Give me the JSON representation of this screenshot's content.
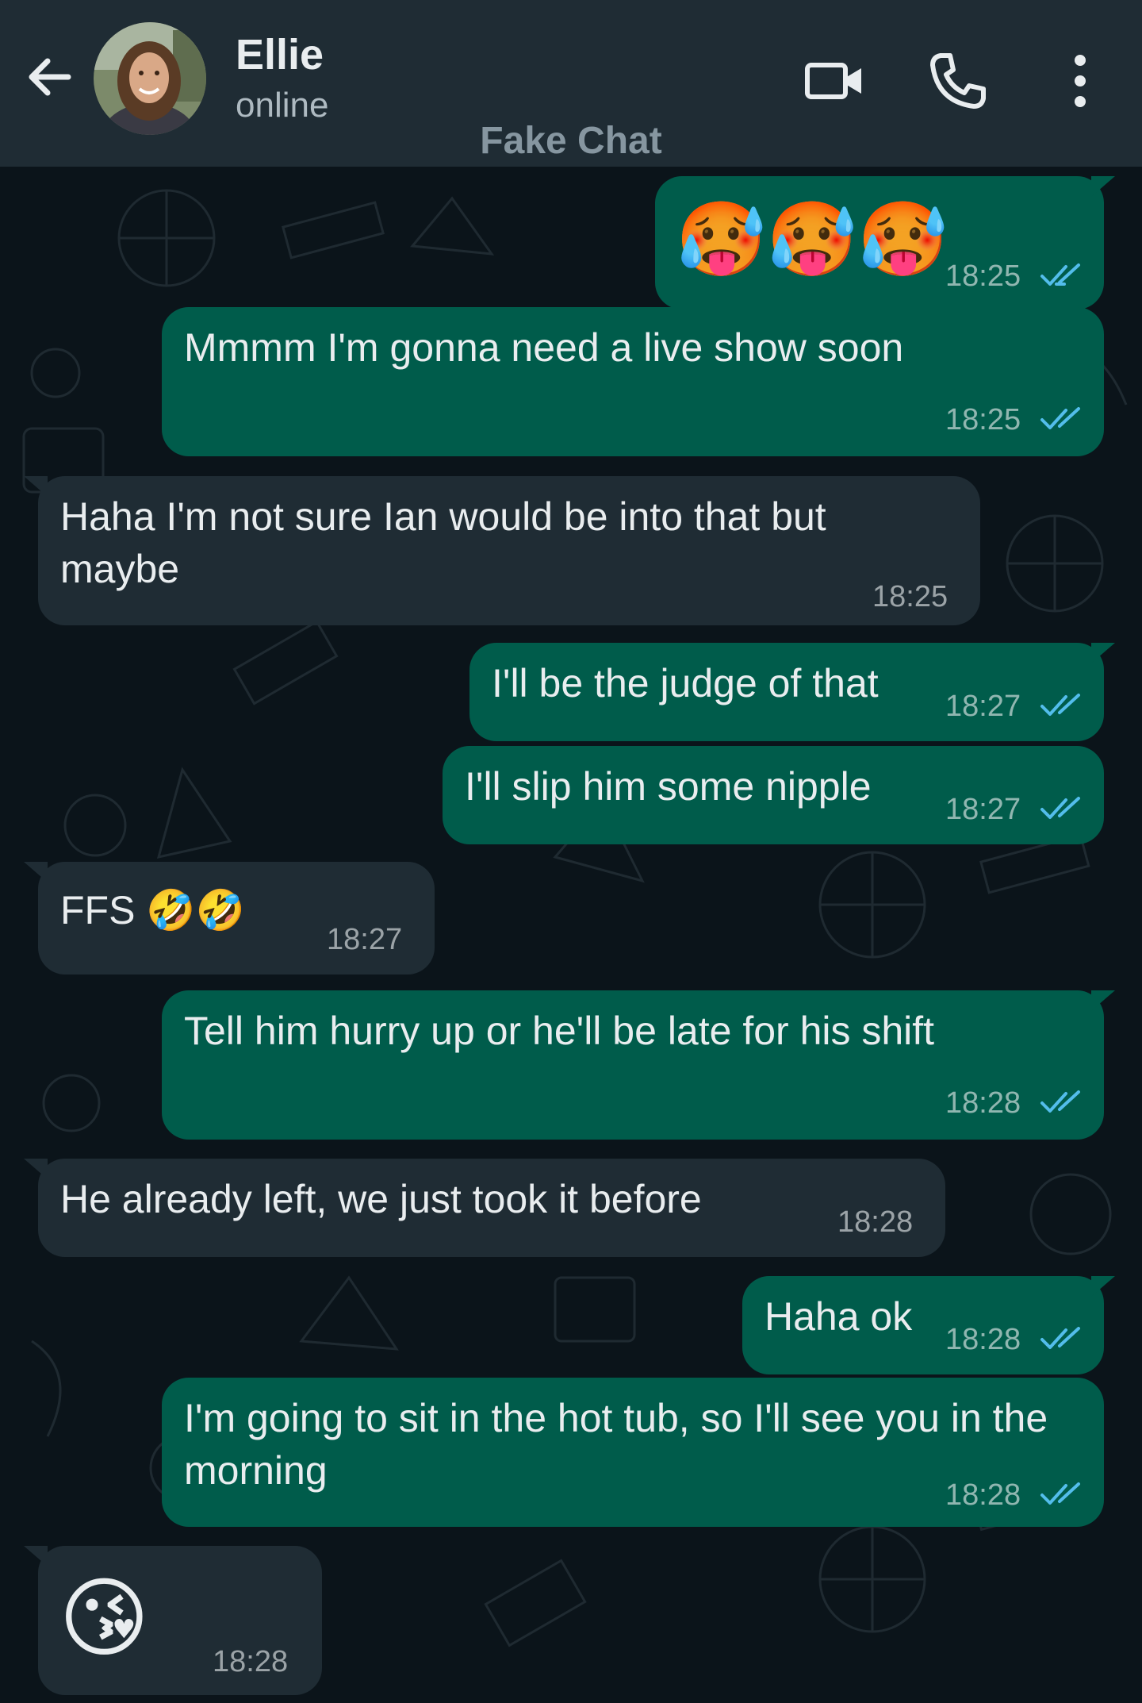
{
  "header": {
    "contact_name": "Ellie",
    "status": "online",
    "watermark": "Fake Chat"
  },
  "colors": {
    "header_bg": "#1f2c34",
    "chat_bg": "#0b141a",
    "outgoing_bubble": "#005c4b",
    "incoming_bubble": "#1f2c34",
    "read_ticks": "#53bdeb",
    "icon": "#e9edef"
  },
  "icons": {
    "back": "arrow-left-icon",
    "video": "video-camera-icon",
    "call": "phone-icon",
    "menu": "kebab-menu-icon",
    "read": "double-check-icon"
  },
  "messages": [
    {
      "dir": "out",
      "text": "🥵🥵🥵",
      "time": "18:25",
      "read": true
    },
    {
      "dir": "out",
      "text": "Mmmm I'm gonna need a live show soon",
      "time": "18:25",
      "read": true
    },
    {
      "dir": "in",
      "text": "Haha I'm not sure Ian would be into that but maybe",
      "time": "18:25"
    },
    {
      "dir": "out",
      "text": "I'll be the judge of that",
      "time": "18:27",
      "read": true
    },
    {
      "dir": "out",
      "text": "I'll slip him some nipple",
      "time": "18:27",
      "read": true
    },
    {
      "dir": "in",
      "text": "FFS 🤣🤣",
      "time": "18:27"
    },
    {
      "dir": "out",
      "text": "Tell him hurry up or he'll be late for his shift",
      "time": "18:28",
      "read": true
    },
    {
      "dir": "in",
      "text": "He already left, we just took it before",
      "time": "18:28"
    },
    {
      "dir": "out",
      "text": "Haha ok",
      "time": "18:28",
      "read": true
    },
    {
      "dir": "out",
      "text": "I'm going to sit in the hot tub, so I'll see you in the morning",
      "time": "18:28",
      "read": true
    },
    {
      "dir": "in",
      "text": "😘",
      "time": "18:28"
    }
  ]
}
